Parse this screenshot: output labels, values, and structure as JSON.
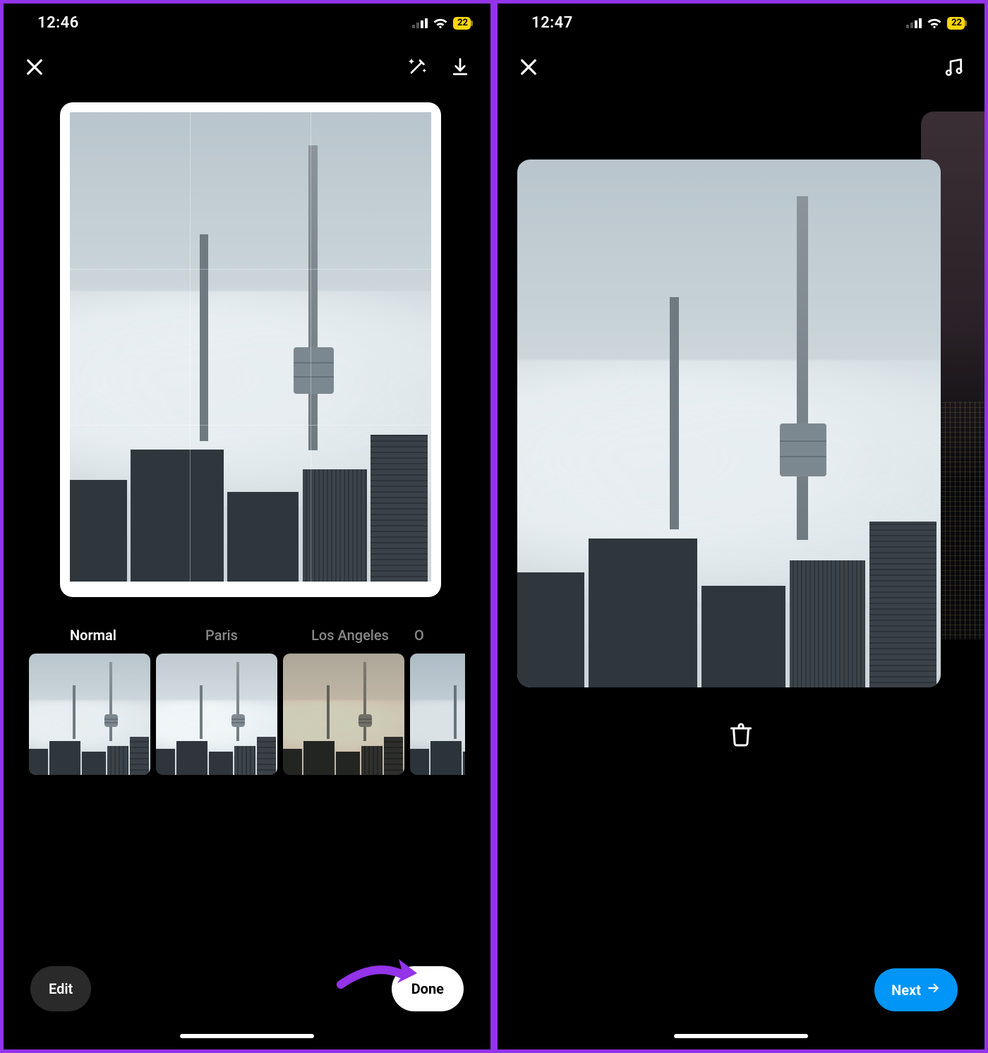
{
  "left": {
    "status": {
      "time": "12:46",
      "battery": "22"
    },
    "filters": [
      {
        "label": "Normal",
        "selected": true
      },
      {
        "label": "Paris",
        "selected": false
      },
      {
        "label": "Los Angeles",
        "selected": false
      },
      {
        "label": "O",
        "selected": false
      }
    ],
    "buttons": {
      "edit": "Edit",
      "done": "Done"
    }
  },
  "right": {
    "status": {
      "time": "12:47",
      "battery": "22"
    },
    "buttons": {
      "next": "Next"
    }
  },
  "icons": {
    "close": "close-icon",
    "magic": "magic-wand-icon",
    "download": "download-icon",
    "music": "music-icon",
    "trash": "trash-icon",
    "arrow_right": "arrow-right-icon",
    "signal": "signal-icon",
    "wifi": "wifi-icon"
  },
  "colors": {
    "accent_purple": "#9333ea",
    "accent_blue": "#0095f6",
    "battery_yellow": "#ffd60a"
  }
}
